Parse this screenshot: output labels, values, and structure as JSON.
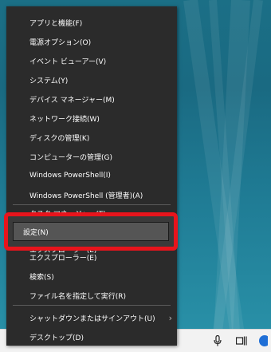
{
  "menu": {
    "items": [
      {
        "label": "アプリと機能(F)"
      },
      {
        "label": "電源オプション(O)"
      },
      {
        "label": "イベント ビューアー(V)"
      },
      {
        "label": "システム(Y)"
      },
      {
        "label": "デバイス マネージャー(M)"
      },
      {
        "label": "ネットワーク接続(W)"
      },
      {
        "label": "ディスクの管理(K)"
      },
      {
        "label": "コンピューターの管理(G)"
      },
      {
        "label": "Windows PowerShell(I)"
      },
      {
        "label": "Windows PowerShell (管理者)(A)"
      },
      {
        "label": "タスク マネージャー(T)"
      },
      {
        "label": "設定(N)"
      },
      {
        "label": "エクスプローラー(E)"
      },
      {
        "label": "検索(S)"
      },
      {
        "label": "ファイル名を指定して実行(R)"
      },
      {
        "label": "シャットダウンまたはサインアウト(U)"
      },
      {
        "label": "デスクトップ(D)"
      }
    ],
    "submenu_arrow": "›"
  },
  "highlight": {
    "color": "#e8141c",
    "label": "設定(N)"
  },
  "taskbar": {
    "mic_icon": "microphone-icon",
    "taskview_icon": "task-view-icon"
  }
}
